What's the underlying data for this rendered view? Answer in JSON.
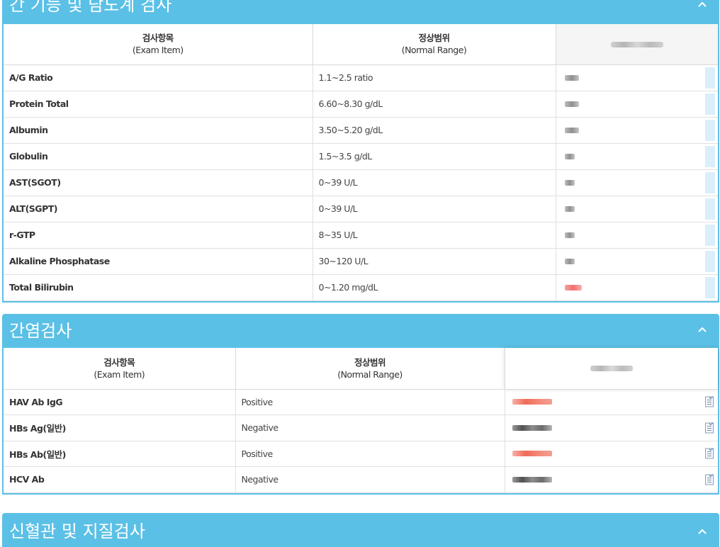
{
  "panel1": {
    "title": "간 기능 및 담도계 검사",
    "headers": {
      "item_ko": "검사항목",
      "item_en": "(Exam Item)",
      "range_ko": "정상범위",
      "range_en": "(Normal Range)"
    },
    "rows": [
      {
        "item": "A/G Ratio",
        "range": "1.1~2.5 ratio",
        "flag": "normal"
      },
      {
        "item": "Protein Total",
        "range": "6.60~8.30 g/dL",
        "flag": "normal"
      },
      {
        "item": "Albumin",
        "range": "3.50~5.20 g/dL",
        "flag": "normal"
      },
      {
        "item": "Globulin",
        "range": "1.5~3.5 g/dL",
        "flag": "normal"
      },
      {
        "item": "AST(SGOT)",
        "range": "0~39 U/L",
        "flag": "normal"
      },
      {
        "item": "ALT(SGPT)",
        "range": "0~39 U/L",
        "flag": "normal"
      },
      {
        "item": "r-GTP",
        "range": "8~35 U/L",
        "flag": "normal"
      },
      {
        "item": "Alkaline Phosphatase",
        "range": "30~120 U/L",
        "flag": "normal"
      },
      {
        "item": "Total Bilirubin",
        "range": "0~1.20 mg/dL",
        "flag": "abnormal"
      }
    ]
  },
  "panel2": {
    "title": "간염검사",
    "headers": {
      "item_ko": "검사항목",
      "item_en": "(Exam Item)",
      "range_ko": "정상범위",
      "range_en": "(Normal Range)"
    },
    "rows": [
      {
        "item": "HAV Ab IgG",
        "range": "Positive",
        "flag": "abnormal"
      },
      {
        "item": "HBs Ag(일반)",
        "range": "Negative",
        "flag": "normal"
      },
      {
        "item": "HBs Ab(일반)",
        "range": "Positive",
        "flag": "abnormal"
      },
      {
        "item": "HCV Ab",
        "range": "Negative",
        "flag": "normal"
      }
    ]
  },
  "panel3": {
    "title": "신혈관 및 지질검사"
  },
  "colors": {
    "header_bg": "#5bc0e6",
    "abnormal": "#f07070"
  },
  "icons": {
    "collapse": "chevron-up-icon",
    "result_detail": "document-list-icon"
  }
}
